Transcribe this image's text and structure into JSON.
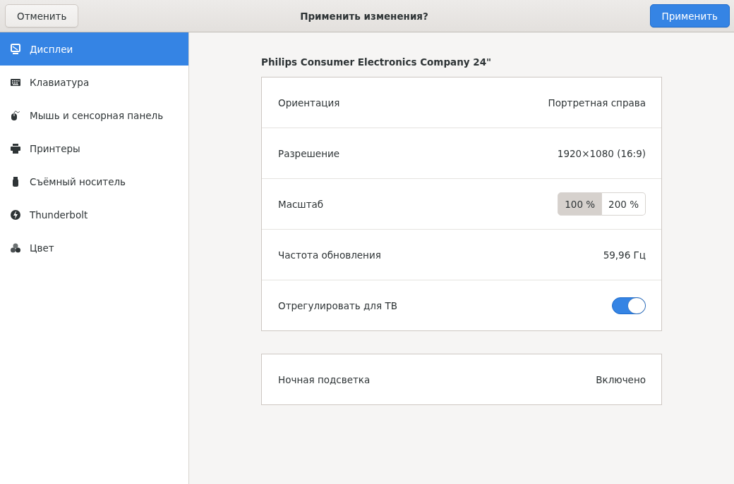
{
  "header": {
    "cancel": "Отменить",
    "title": "Применить изменения?",
    "apply": "Применить"
  },
  "sidebar": {
    "items": [
      {
        "label": "Дисплеи",
        "selected": true
      },
      {
        "label": "Клавиатура",
        "selected": false
      },
      {
        "label": "Мышь и сенсорная панель",
        "selected": false
      },
      {
        "label": "Принтеры",
        "selected": false
      },
      {
        "label": "Съёмный носитель",
        "selected": false
      },
      {
        "label": "Thunderbolt",
        "selected": false
      },
      {
        "label": "Цвет",
        "selected": false
      }
    ]
  },
  "monitor": {
    "title": "Philips Consumer Electronics Company 24\"",
    "rows": [
      {
        "kind": "value",
        "label": "Ориентация",
        "value": "Портретная справа"
      },
      {
        "kind": "value",
        "label": "Разрешение",
        "value": "1920×1080 (16:9)"
      },
      {
        "kind": "scale",
        "label": "Масштаб",
        "options": [
          {
            "label": "100 %",
            "selected": true
          },
          {
            "label": "200 %",
            "selected": false
          }
        ]
      },
      {
        "kind": "value",
        "label": "Частота обновления",
        "value": "59,96 Гц"
      },
      {
        "kind": "toggle",
        "label": "Отрегулировать для ТВ",
        "on": true
      }
    ]
  },
  "night_light": {
    "label": "Ночная подсветка",
    "value": "Включено"
  }
}
